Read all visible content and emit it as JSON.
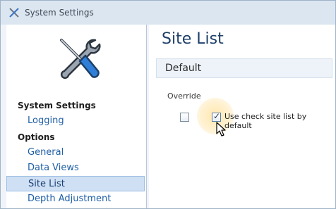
{
  "window": {
    "title": "System Settings",
    "app_icon": "tools-icon"
  },
  "sidebar": {
    "logo_icon": "screwdriver-wrench-icon",
    "sections": [
      {
        "header": "System Settings",
        "items": [
          {
            "label": "Logging",
            "selected": false
          }
        ]
      },
      {
        "header": "Options",
        "items": [
          {
            "label": "General",
            "selected": false
          },
          {
            "label": "Data Views",
            "selected": false
          },
          {
            "label": "Site List",
            "selected": true
          },
          {
            "label": "Depth Adjustment",
            "selected": false
          }
        ]
      }
    ]
  },
  "main": {
    "page_title": "Site List",
    "section": {
      "title": "Default",
      "override_label": "Override",
      "override_checkbox": {
        "checked": false
      },
      "use_check_site_list": {
        "label": "Use check site list by default",
        "checked": true
      }
    }
  },
  "colors": {
    "link": "#1f5fa6",
    "selection": "#cfe0f4",
    "title": "#1e3f6a"
  }
}
